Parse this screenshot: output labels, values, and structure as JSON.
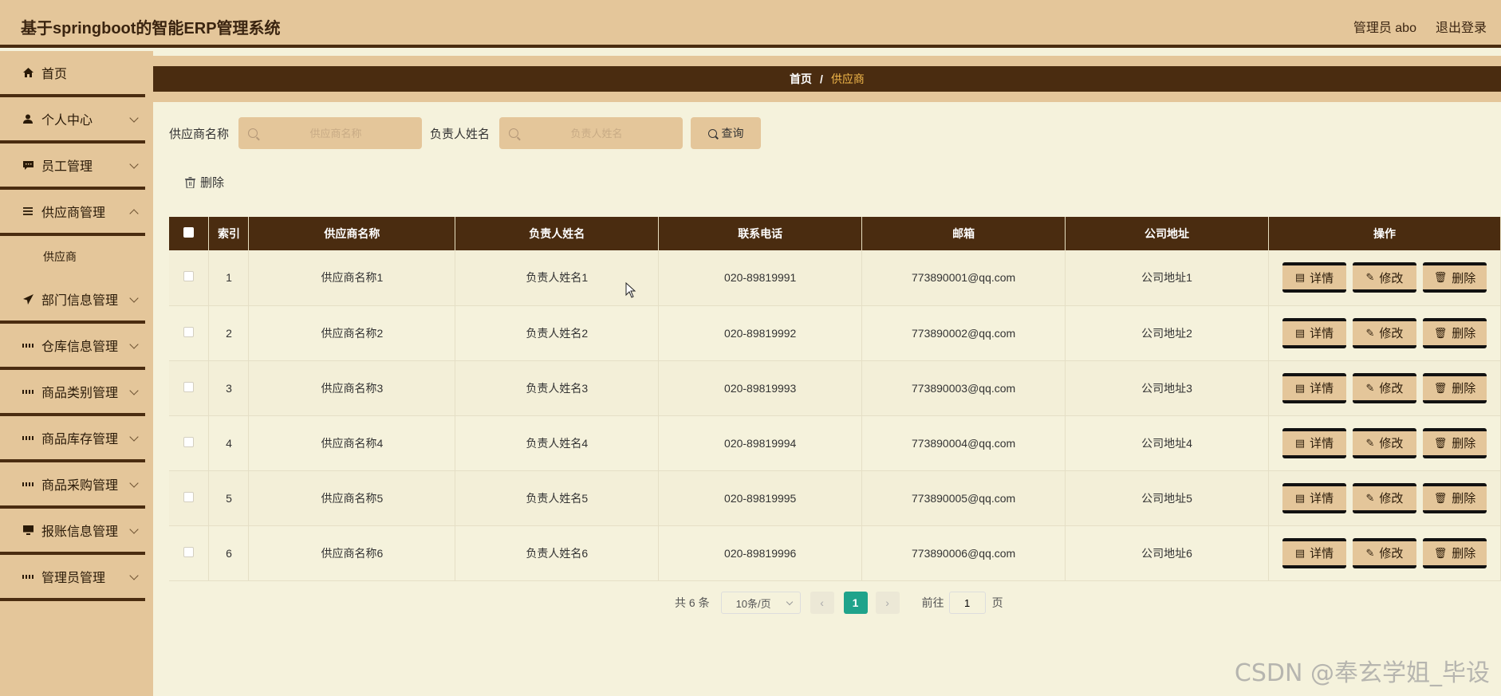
{
  "header": {
    "title": "基于springboot的智能ERP管理系统",
    "admin": "管理员 abo",
    "logout": "退出登录"
  },
  "sidebar": {
    "items": [
      {
        "label": "首页",
        "icon": "home-icon"
      },
      {
        "label": "个人中心",
        "icon": "user-icon"
      },
      {
        "label": "员工管理",
        "icon": "chat-icon"
      },
      {
        "label": "供应商管理",
        "icon": "list-icon"
      },
      {
        "label": "供应商",
        "icon": ""
      },
      {
        "label": "部门信息管理",
        "icon": "send-icon"
      },
      {
        "label": "仓库信息管理",
        "icon": "grid-icon"
      },
      {
        "label": "商品类别管理",
        "icon": "grid-icon"
      },
      {
        "label": "商品库存管理",
        "icon": "grid-icon"
      },
      {
        "label": "商品采购管理",
        "icon": "grid-icon"
      },
      {
        "label": "报账信息管理",
        "icon": "monitor-icon"
      },
      {
        "label": "管理员管理",
        "icon": "grid-icon"
      }
    ]
  },
  "breadcrumb": {
    "home": "首页",
    "separator": "/",
    "current": "供应商"
  },
  "search": {
    "name_label": "供应商名称",
    "name_placeholder": "供应商名称",
    "person_label": "负责人姓名",
    "person_placeholder": "负责人姓名",
    "query_button": "查询"
  },
  "toolbar": {
    "delete_label": "删除"
  },
  "table": {
    "headers": [
      "索引",
      "供应商名称",
      "负责人姓名",
      "联系电话",
      "邮箱",
      "公司地址",
      "操作"
    ],
    "rows": [
      [
        "1",
        "供应商名称1",
        "负责人姓名1",
        "020-89819991",
        "773890001@qq.com",
        "公司地址1"
      ],
      [
        "2",
        "供应商名称2",
        "负责人姓名2",
        "020-89819992",
        "773890002@qq.com",
        "公司地址2"
      ],
      [
        "3",
        "供应商名称3",
        "负责人姓名3",
        "020-89819993",
        "773890003@qq.com",
        "公司地址3"
      ],
      [
        "4",
        "供应商名称4",
        "负责人姓名4",
        "020-89819994",
        "773890004@qq.com",
        "公司地址4"
      ],
      [
        "5",
        "供应商名称5",
        "负责人姓名5",
        "020-89819995",
        "773890005@qq.com",
        "公司地址5"
      ],
      [
        "6",
        "供应商名称6",
        "负责人姓名6",
        "020-89819996",
        "773890006@qq.com",
        "公司地址6"
      ]
    ],
    "actions": {
      "detail": "详情",
      "edit": "修改",
      "delete": "删除"
    }
  },
  "pagination": {
    "total": "共 6 条",
    "page_size": "10条/页",
    "current_page": "1",
    "goto_label": "前往",
    "goto_value": "1",
    "page_suffix": "页"
  },
  "watermark": "CSDN @奉玄学姐_毕设",
  "colors": {
    "header_bg": "#e4c69a",
    "dark_brown": "#4a2c10",
    "content_bg": "#f5f2dc",
    "active_page": "#1fa38b",
    "crumb_current": "#f2b84a"
  }
}
